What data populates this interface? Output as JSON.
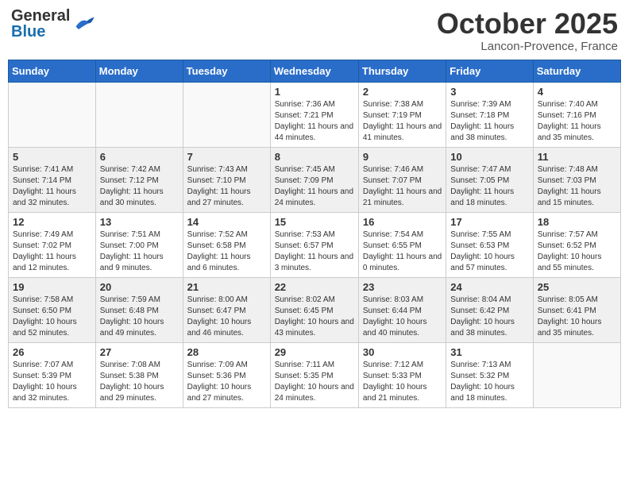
{
  "header": {
    "logo": {
      "general": "General",
      "blue": "Blue"
    },
    "month": "October 2025",
    "location": "Lancon-Provence, France"
  },
  "weekdays": [
    "Sunday",
    "Monday",
    "Tuesday",
    "Wednesday",
    "Thursday",
    "Friday",
    "Saturday"
  ],
  "weeks": [
    [
      {
        "day": "",
        "sunrise": "",
        "sunset": "",
        "daylight": ""
      },
      {
        "day": "",
        "sunrise": "",
        "sunset": "",
        "daylight": ""
      },
      {
        "day": "",
        "sunrise": "",
        "sunset": "",
        "daylight": ""
      },
      {
        "day": "1",
        "sunrise": "Sunrise: 7:36 AM",
        "sunset": "Sunset: 7:21 PM",
        "daylight": "Daylight: 11 hours and 44 minutes."
      },
      {
        "day": "2",
        "sunrise": "Sunrise: 7:38 AM",
        "sunset": "Sunset: 7:19 PM",
        "daylight": "Daylight: 11 hours and 41 minutes."
      },
      {
        "day": "3",
        "sunrise": "Sunrise: 7:39 AM",
        "sunset": "Sunset: 7:18 PM",
        "daylight": "Daylight: 11 hours and 38 minutes."
      },
      {
        "day": "4",
        "sunrise": "Sunrise: 7:40 AM",
        "sunset": "Sunset: 7:16 PM",
        "daylight": "Daylight: 11 hours and 35 minutes."
      }
    ],
    [
      {
        "day": "5",
        "sunrise": "Sunrise: 7:41 AM",
        "sunset": "Sunset: 7:14 PM",
        "daylight": "Daylight: 11 hours and 32 minutes."
      },
      {
        "day": "6",
        "sunrise": "Sunrise: 7:42 AM",
        "sunset": "Sunset: 7:12 PM",
        "daylight": "Daylight: 11 hours and 30 minutes."
      },
      {
        "day": "7",
        "sunrise": "Sunrise: 7:43 AM",
        "sunset": "Sunset: 7:10 PM",
        "daylight": "Daylight: 11 hours and 27 minutes."
      },
      {
        "day": "8",
        "sunrise": "Sunrise: 7:45 AM",
        "sunset": "Sunset: 7:09 PM",
        "daylight": "Daylight: 11 hours and 24 minutes."
      },
      {
        "day": "9",
        "sunrise": "Sunrise: 7:46 AM",
        "sunset": "Sunset: 7:07 PM",
        "daylight": "Daylight: 11 hours and 21 minutes."
      },
      {
        "day": "10",
        "sunrise": "Sunrise: 7:47 AM",
        "sunset": "Sunset: 7:05 PM",
        "daylight": "Daylight: 11 hours and 18 minutes."
      },
      {
        "day": "11",
        "sunrise": "Sunrise: 7:48 AM",
        "sunset": "Sunset: 7:03 PM",
        "daylight": "Daylight: 11 hours and 15 minutes."
      }
    ],
    [
      {
        "day": "12",
        "sunrise": "Sunrise: 7:49 AM",
        "sunset": "Sunset: 7:02 PM",
        "daylight": "Daylight: 11 hours and 12 minutes."
      },
      {
        "day": "13",
        "sunrise": "Sunrise: 7:51 AM",
        "sunset": "Sunset: 7:00 PM",
        "daylight": "Daylight: 11 hours and 9 minutes."
      },
      {
        "day": "14",
        "sunrise": "Sunrise: 7:52 AM",
        "sunset": "Sunset: 6:58 PM",
        "daylight": "Daylight: 11 hours and 6 minutes."
      },
      {
        "day": "15",
        "sunrise": "Sunrise: 7:53 AM",
        "sunset": "Sunset: 6:57 PM",
        "daylight": "Daylight: 11 hours and 3 minutes."
      },
      {
        "day": "16",
        "sunrise": "Sunrise: 7:54 AM",
        "sunset": "Sunset: 6:55 PM",
        "daylight": "Daylight: 11 hours and 0 minutes."
      },
      {
        "day": "17",
        "sunrise": "Sunrise: 7:55 AM",
        "sunset": "Sunset: 6:53 PM",
        "daylight": "Daylight: 10 hours and 57 minutes."
      },
      {
        "day": "18",
        "sunrise": "Sunrise: 7:57 AM",
        "sunset": "Sunset: 6:52 PM",
        "daylight": "Daylight: 10 hours and 55 minutes."
      }
    ],
    [
      {
        "day": "19",
        "sunrise": "Sunrise: 7:58 AM",
        "sunset": "Sunset: 6:50 PM",
        "daylight": "Daylight: 10 hours and 52 minutes."
      },
      {
        "day": "20",
        "sunrise": "Sunrise: 7:59 AM",
        "sunset": "Sunset: 6:48 PM",
        "daylight": "Daylight: 10 hours and 49 minutes."
      },
      {
        "day": "21",
        "sunrise": "Sunrise: 8:00 AM",
        "sunset": "Sunset: 6:47 PM",
        "daylight": "Daylight: 10 hours and 46 minutes."
      },
      {
        "day": "22",
        "sunrise": "Sunrise: 8:02 AM",
        "sunset": "Sunset: 6:45 PM",
        "daylight": "Daylight: 10 hours and 43 minutes."
      },
      {
        "day": "23",
        "sunrise": "Sunrise: 8:03 AM",
        "sunset": "Sunset: 6:44 PM",
        "daylight": "Daylight: 10 hours and 40 minutes."
      },
      {
        "day": "24",
        "sunrise": "Sunrise: 8:04 AM",
        "sunset": "Sunset: 6:42 PM",
        "daylight": "Daylight: 10 hours and 38 minutes."
      },
      {
        "day": "25",
        "sunrise": "Sunrise: 8:05 AM",
        "sunset": "Sunset: 6:41 PM",
        "daylight": "Daylight: 10 hours and 35 minutes."
      }
    ],
    [
      {
        "day": "26",
        "sunrise": "Sunrise: 7:07 AM",
        "sunset": "Sunset: 5:39 PM",
        "daylight": "Daylight: 10 hours and 32 minutes."
      },
      {
        "day": "27",
        "sunrise": "Sunrise: 7:08 AM",
        "sunset": "Sunset: 5:38 PM",
        "daylight": "Daylight: 10 hours and 29 minutes."
      },
      {
        "day": "28",
        "sunrise": "Sunrise: 7:09 AM",
        "sunset": "Sunset: 5:36 PM",
        "daylight": "Daylight: 10 hours and 27 minutes."
      },
      {
        "day": "29",
        "sunrise": "Sunrise: 7:11 AM",
        "sunset": "Sunset: 5:35 PM",
        "daylight": "Daylight: 10 hours and 24 minutes."
      },
      {
        "day": "30",
        "sunrise": "Sunrise: 7:12 AM",
        "sunset": "Sunset: 5:33 PM",
        "daylight": "Daylight: 10 hours and 21 minutes."
      },
      {
        "day": "31",
        "sunrise": "Sunrise: 7:13 AM",
        "sunset": "Sunset: 5:32 PM",
        "daylight": "Daylight: 10 hours and 18 minutes."
      },
      {
        "day": "",
        "sunrise": "",
        "sunset": "",
        "daylight": ""
      }
    ]
  ]
}
